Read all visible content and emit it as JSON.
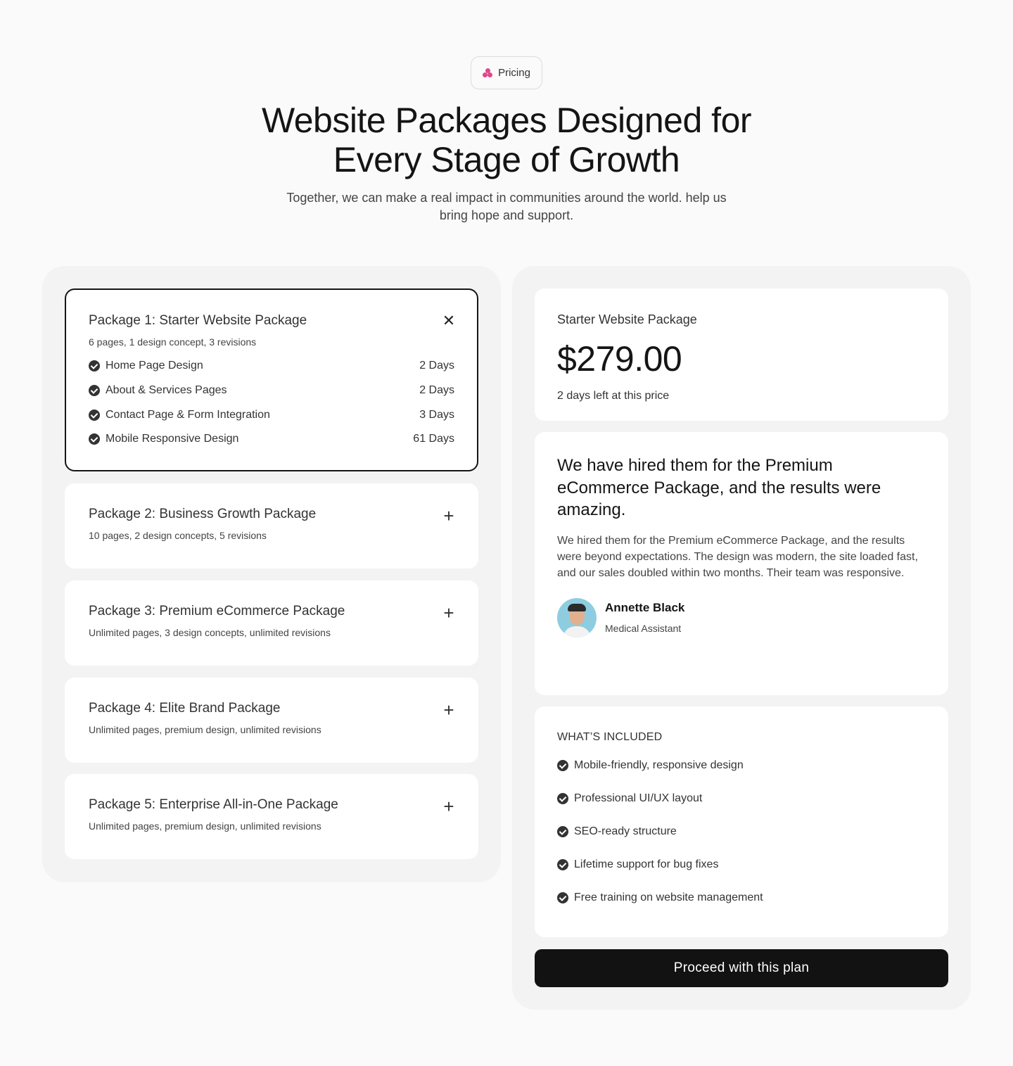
{
  "header": {
    "badge": "Pricing",
    "title": "Website Packages Designed for Every Stage of Growth",
    "subtitle": "Together, we can make a real impact in communities around the world. help us bring hope and support."
  },
  "packages": [
    {
      "title": "Package 1: Starter Website Package",
      "subtitle": "6 pages, 1 design concept, 3 revisions",
      "toggle": "✕",
      "expanded": true,
      "features": [
        {
          "name": "Home Page Design",
          "days": "2 Days"
        },
        {
          "name": "About & Services Pages",
          "days": "2 Days"
        },
        {
          "name": "Contact Page & Form Integration",
          "days": "3 Days"
        },
        {
          "name": "Mobile Responsive Design",
          "days": "61 Days"
        }
      ]
    },
    {
      "title": "Package 2: Business Growth Package",
      "subtitle": "10 pages, 2 design concepts, 5 revisions",
      "toggle": "+",
      "expanded": false
    },
    {
      "title": "Package 3: Premium eCommerce Package",
      "subtitle": "Unlimited pages, 3 design concepts, unlimited revisions",
      "toggle": "+",
      "expanded": false
    },
    {
      "title": "Package 4: Elite Brand Package",
      "subtitle": "Unlimited pages, premium design, unlimited revisions",
      "toggle": "+",
      "expanded": false
    },
    {
      "title": "Package 5: Enterprise All-in-One Package",
      "subtitle": "Unlimited pages, premium design, unlimited revisions",
      "toggle": "+",
      "expanded": false
    }
  ],
  "summary": {
    "name": "Starter Website Package",
    "price": "$279.00",
    "note": "2 days left at this price"
  },
  "testimonial": {
    "headline": "We have hired them for the Premium eCommerce Package, and the results were amazing.",
    "body": "We hired them for the Premium eCommerce Package, and the results were beyond expectations. The design was modern, the site loaded fast, and our sales doubled within two months. Their team was responsive.",
    "author": "Annette Black",
    "role": "Medical Assistant"
  },
  "included": {
    "title": "WHAT’S INCLUDED",
    "items": [
      "Mobile-friendly, responsive design",
      "Professional UI/UX layout",
      "SEO-ready structure",
      "Lifetime support for bug fixes",
      "Free training on website management"
    ]
  },
  "cta": "Proceed with this plan",
  "colors": {
    "accent": "#e0488b",
    "dark": "#121212"
  }
}
